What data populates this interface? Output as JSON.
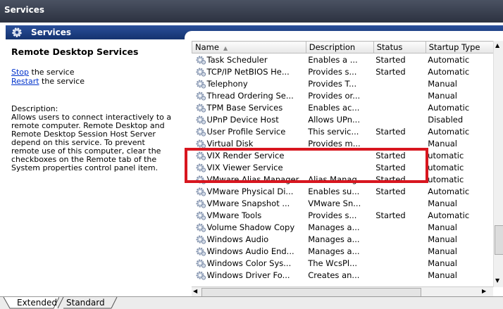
{
  "window": {
    "title": "Services"
  },
  "header": {
    "label": "Services",
    "icon": "gear-icon"
  },
  "left_pane": {
    "service_name": "Remote Desktop Services",
    "stop_link": "Stop",
    "stop_suffix": " the service",
    "restart_link": "Restart",
    "restart_suffix": " the service",
    "description_label": "Description:",
    "description_lines": [
      "Allows users to connect interactively to a",
      "remote computer. Remote Desktop and",
      "Remote Desktop Session Host Server",
      "depend on this service.  To prevent",
      "remote use of this computer, clear the",
      "checkboxes on the Remote tab of the",
      "System properties control panel item."
    ]
  },
  "table": {
    "columns": [
      "Name",
      "Description",
      "Status",
      "Startup Type"
    ],
    "rows": [
      [
        "Task Scheduler",
        "Enables a ...",
        "Started",
        "Automatic"
      ],
      [
        "TCP/IP NetBIOS He...",
        "Provides s...",
        "Started",
        "Automatic"
      ],
      [
        "Telephony",
        "Provides T...",
        "",
        "Manual"
      ],
      [
        "Thread Ordering Se...",
        "Provides or...",
        "",
        "Manual"
      ],
      [
        "TPM Base Services",
        "Enables ac...",
        "",
        "Automatic"
      ],
      [
        "UPnP Device Host",
        "Allows UPn...",
        "",
        "Disabled"
      ],
      [
        "User Profile Service",
        "This servic...",
        "Started",
        "Automatic"
      ],
      [
        "Virtual Disk",
        "Provides m...",
        "",
        "Manual"
      ],
      [
        "VIX Render Service",
        "",
        "Started",
        "utomatic"
      ],
      [
        "VIX Viewer Service",
        "",
        "Started",
        "utomatic"
      ],
      [
        "VMware Alias Manager...",
        "Alias Manag...",
        "Started",
        "utomatic"
      ],
      [
        "VMware Physical Di...",
        "Enables su...",
        "Started",
        "Automatic"
      ],
      [
        "VMware Snapshot ...",
        "VMware Sn...",
        "",
        "Manual"
      ],
      [
        "VMware Tools",
        "Provides s...",
        "Started",
        "Automatic"
      ],
      [
        "Volume Shadow Copy",
        "Manages a...",
        "",
        "Manual"
      ],
      [
        "Windows Audio",
        "Manages a...",
        "",
        "Manual"
      ],
      [
        "Windows Audio End...",
        "Manages a...",
        "",
        "Manual"
      ],
      [
        "Windows Color Sys...",
        "The WcsPl...",
        "",
        "Manual"
      ],
      [
        "Windows Driver Fo...",
        "Creates an...",
        "",
        "Manual"
      ]
    ]
  },
  "tabs": [
    "Extended",
    "Standard"
  ],
  "colors": {
    "highlight": "#d8161f",
    "header_bg": "#1e3f86",
    "link": "#0033cc"
  }
}
